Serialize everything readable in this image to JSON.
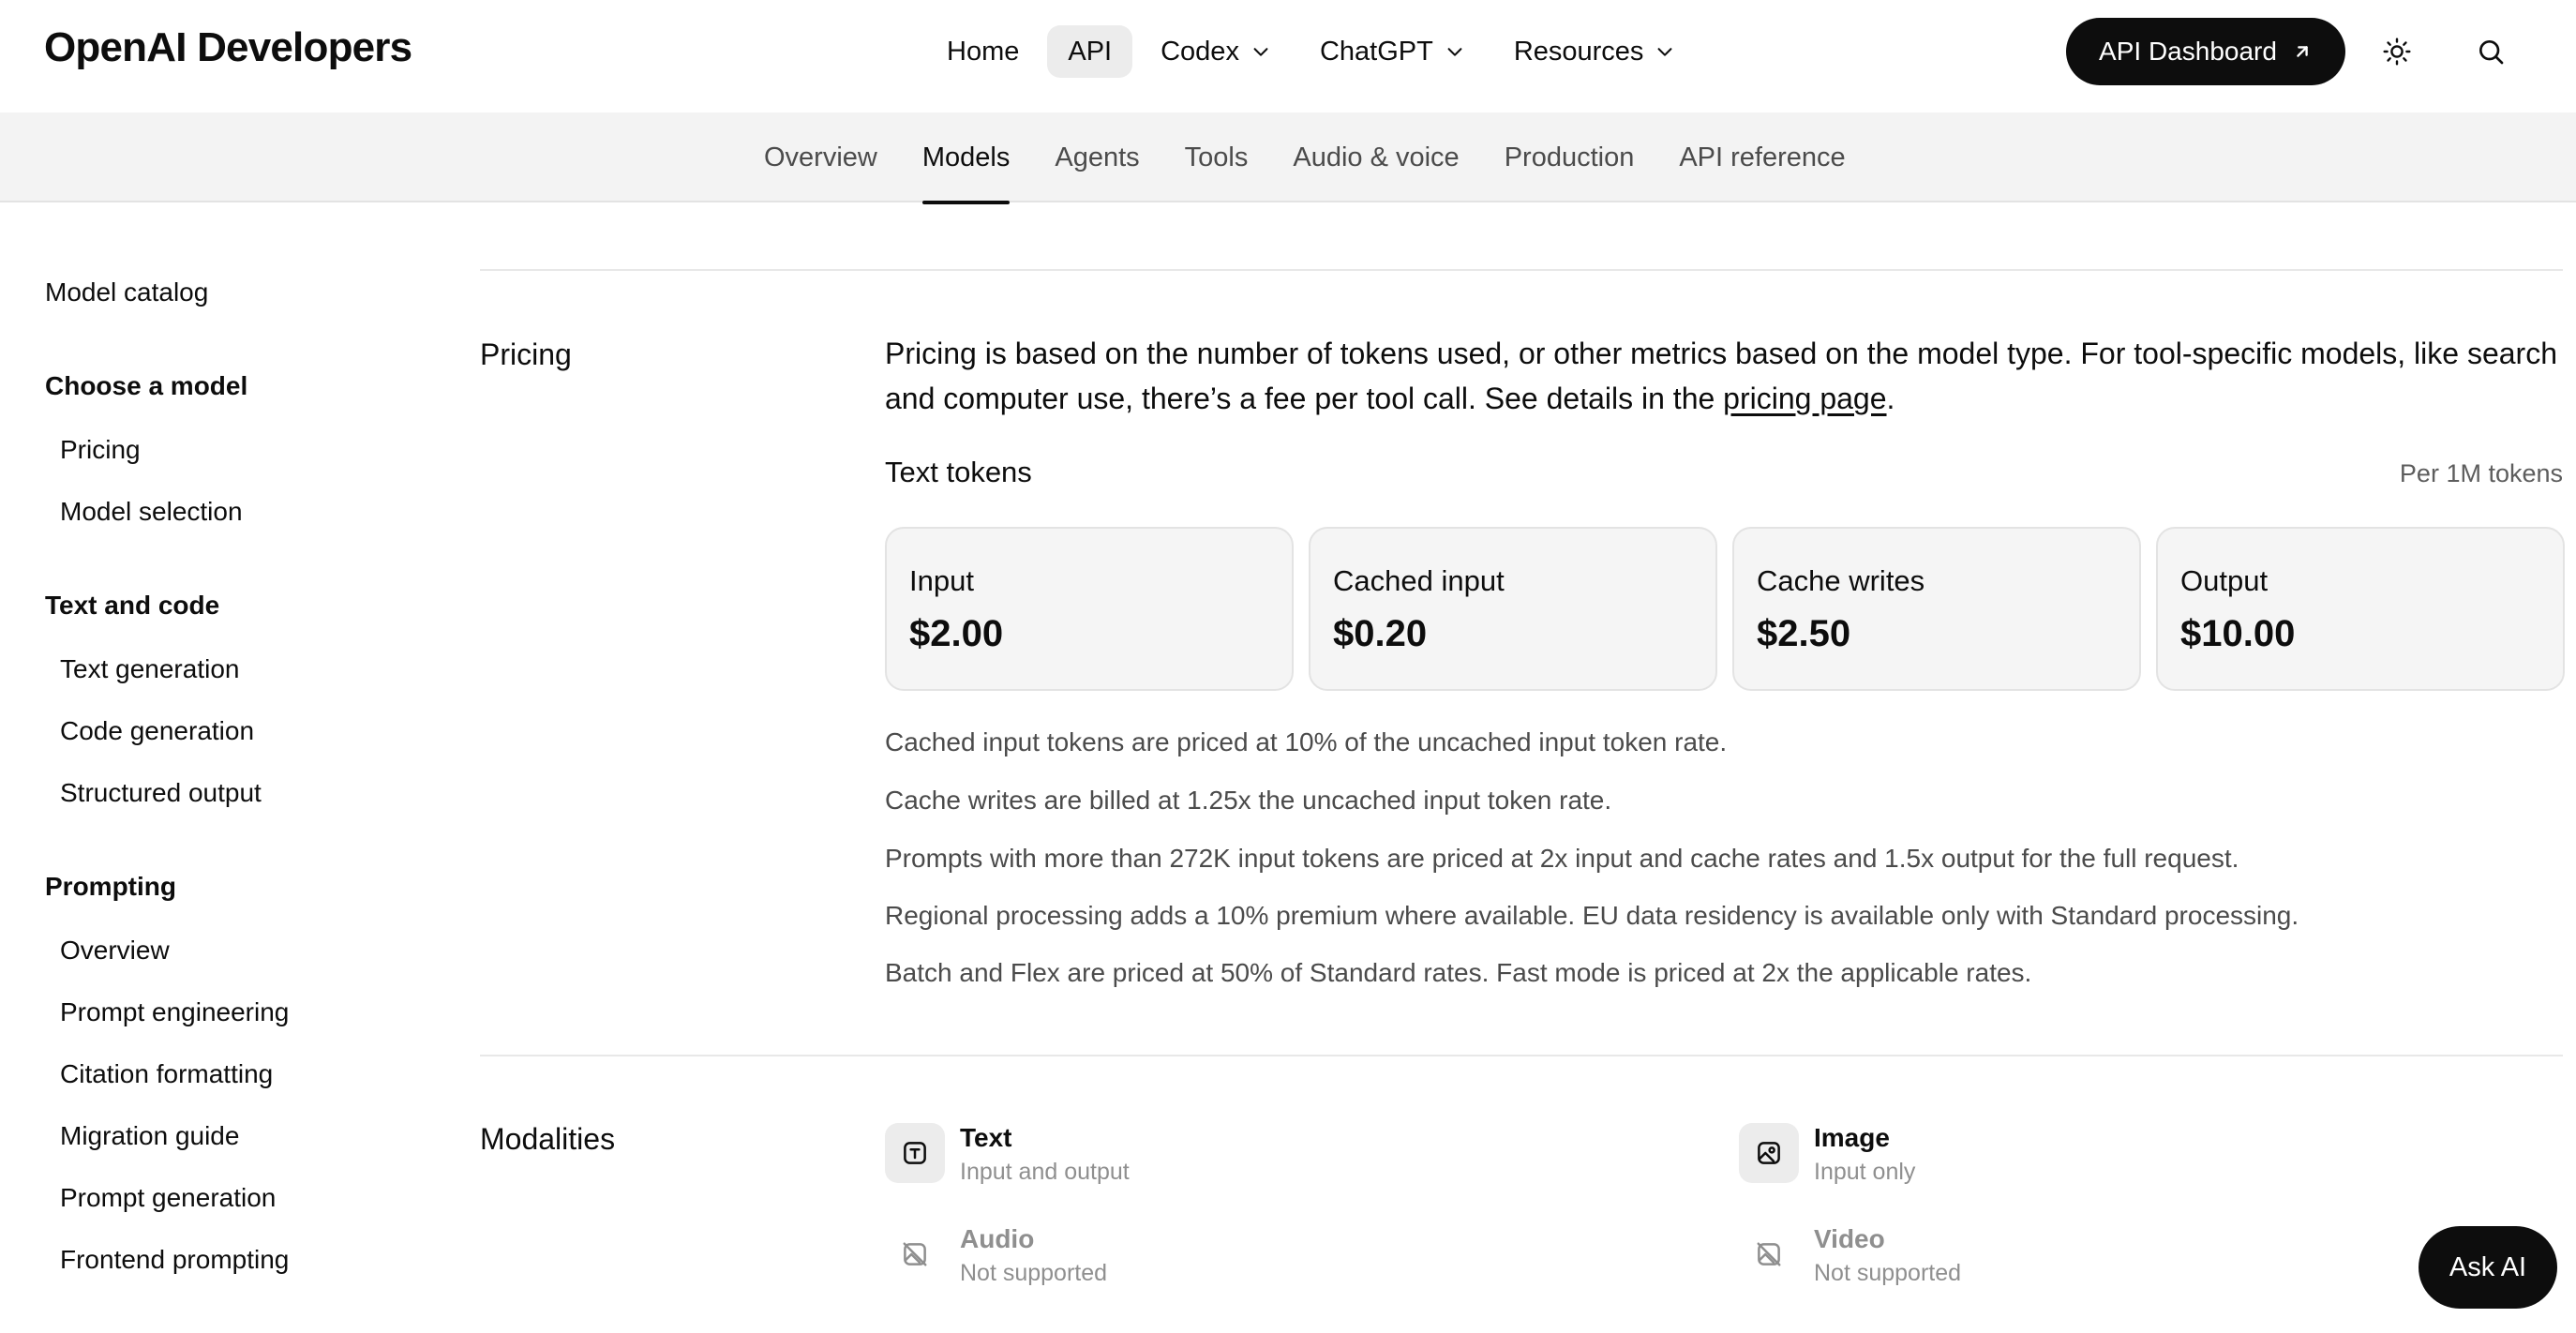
{
  "brand": "OpenAI Developers",
  "nav": {
    "items": [
      {
        "label": "Home",
        "dropdown": false,
        "active": false
      },
      {
        "label": "API",
        "dropdown": false,
        "active": true
      },
      {
        "label": "Codex",
        "dropdown": true,
        "active": false
      },
      {
        "label": "ChatGPT",
        "dropdown": true,
        "active": false
      },
      {
        "label": "Resources",
        "dropdown": true,
        "active": false
      }
    ],
    "dashboard_label": "API Dashboard"
  },
  "subnav": {
    "items": [
      "Overview",
      "Models",
      "Agents",
      "Tools",
      "Audio & voice",
      "Production",
      "API reference"
    ],
    "active": "Models"
  },
  "sidebar": {
    "top": "Model catalog",
    "groups": [
      {
        "title": "Choose a model",
        "items": [
          "Pricing",
          "Model selection"
        ]
      },
      {
        "title": "Text and code",
        "items": [
          "Text generation",
          "Code generation",
          "Structured output"
        ]
      },
      {
        "title": "Prompting",
        "items": [
          "Overview",
          "Prompt engineering",
          "Citation formatting",
          "Migration guide",
          "Prompt generation",
          "Frontend prompting"
        ]
      }
    ]
  },
  "pricing": {
    "label": "Pricing",
    "desc_before": "Pricing is based on the number of tokens used, or other metrics based on the model type. For tool-specific models, like search and computer use, there’s a fee per tool call. See details in the ",
    "desc_link": "pricing page",
    "desc_after": ".",
    "tokens_title": "Text tokens",
    "per_tokens": "Per 1M tokens",
    "cards": [
      {
        "label": "Input",
        "value": "$2.00"
      },
      {
        "label": "Cached input",
        "value": "$0.20"
      },
      {
        "label": "Cache writes",
        "value": "$2.50"
      },
      {
        "label": "Output",
        "value": "$10.00"
      }
    ],
    "notes": [
      "Cached input tokens are priced at 10% of the uncached input token rate.",
      "Cache writes are billed at 1.25x the uncached input token rate.",
      "Prompts with more than 272K input tokens are priced at 2x input and cache rates and 1.5x output for the full request.",
      "Regional processing adds a 10% premium where available. EU data residency is available only with Standard processing.",
      "Batch and Flex are priced at 50% of Standard rates. Fast mode is priced at 2x the applicable rates."
    ]
  },
  "modalities": {
    "label": "Modalities",
    "items": [
      {
        "name": "Text",
        "desc": "Input and output",
        "icon": "text-icon",
        "supported": true
      },
      {
        "name": "Image",
        "desc": "Input only",
        "icon": "image-icon",
        "supported": true
      },
      {
        "name": "Audio",
        "desc": "Not supported",
        "icon": "image-off-icon",
        "supported": false
      },
      {
        "name": "Video",
        "desc": "Not supported",
        "icon": "image-off-icon",
        "supported": false
      }
    ]
  },
  "ask_ai": "Ask AI"
}
